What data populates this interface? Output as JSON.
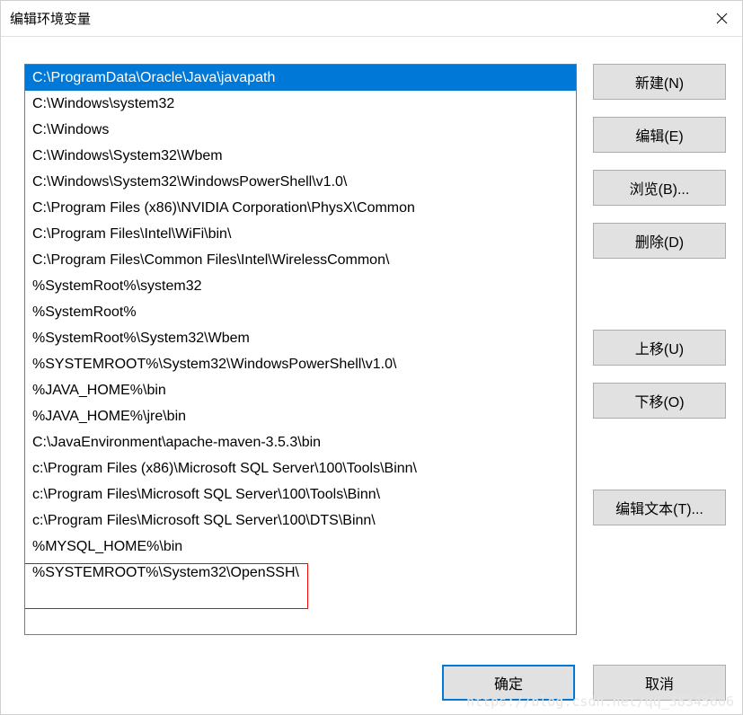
{
  "window": {
    "title": "编辑环境变量"
  },
  "list": {
    "items": [
      "C:\\ProgramData\\Oracle\\Java\\javapath",
      "C:\\Windows\\system32",
      "C:\\Windows",
      "C:\\Windows\\System32\\Wbem",
      "C:\\Windows\\System32\\WindowsPowerShell\\v1.0\\",
      "C:\\Program Files (x86)\\NVIDIA Corporation\\PhysX\\Common",
      "C:\\Program Files\\Intel\\WiFi\\bin\\",
      "C:\\Program Files\\Common Files\\Intel\\WirelessCommon\\",
      "%SystemRoot%\\system32",
      "%SystemRoot%",
      "%SystemRoot%\\System32\\Wbem",
      "%SYSTEMROOT%\\System32\\WindowsPowerShell\\v1.0\\",
      "%JAVA_HOME%\\bin",
      "%JAVA_HOME%\\jre\\bin",
      "C:\\JavaEnvironment\\apache-maven-3.5.3\\bin",
      "c:\\Program Files (x86)\\Microsoft SQL Server\\100\\Tools\\Binn\\",
      "c:\\Program Files\\Microsoft SQL Server\\100\\Tools\\Binn\\",
      "c:\\Program Files\\Microsoft SQL Server\\100\\DTS\\Binn\\",
      "%MYSQL_HOME%\\bin",
      "%SYSTEMROOT%\\System32\\OpenSSH\\"
    ],
    "selected_index": 0,
    "highlighted_index": 18
  },
  "buttons": {
    "new": "新建(N)",
    "edit": "编辑(E)",
    "browse": "浏览(B)...",
    "delete": "删除(D)",
    "move_up": "上移(U)",
    "move_down": "下移(O)",
    "edit_text": "编辑文本(T)..."
  },
  "footer": {
    "ok": "确定",
    "cancel": "取消"
  },
  "watermark": "https://blog.csdn.net/qq_38345606"
}
